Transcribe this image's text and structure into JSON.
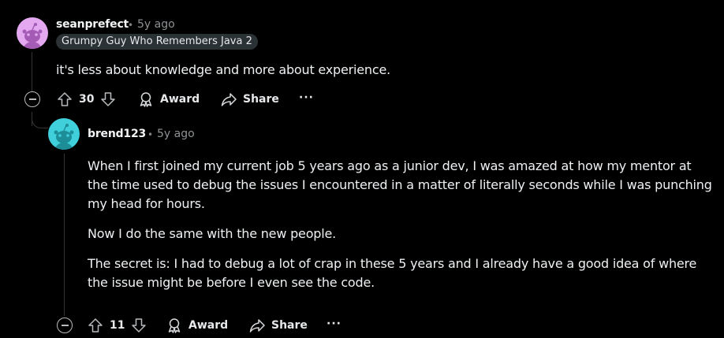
{
  "comments": [
    {
      "username": "seanprefect",
      "separator": "•",
      "timestamp": "5y ago",
      "flair": "Grumpy Guy Who Remembers Java 2",
      "paragraphs": [
        "it's less about knowledge and more about experience."
      ],
      "avatar_color": "#e3a8f0",
      "votes": "30",
      "award_label": "Award",
      "share_label": "Share",
      "more_label": "···"
    },
    {
      "username": "brend123",
      "separator": "•",
      "timestamp": "5y ago",
      "paragraphs": [
        "When I first joined my current job 5 years ago as a junior dev, I was amazed at how my mentor at the time used to debug the issues I encountered in a matter of literally seconds while I was punching my head for hours.",
        "Now I do the same with the new people.",
        "The secret is: I had to debug a lot of crap in these 5 years and I already have a good idea of where the issue might be before I even see the code."
      ],
      "avatar_color": "#3fd0dc",
      "votes": "11",
      "award_label": "Award",
      "share_label": "Share",
      "more_label": "···"
    }
  ],
  "icons": {
    "collapse": "minus-circle-icon",
    "upvote": "arrow-up-icon",
    "downvote": "arrow-down-icon",
    "award": "award-icon",
    "share": "share-icon"
  }
}
